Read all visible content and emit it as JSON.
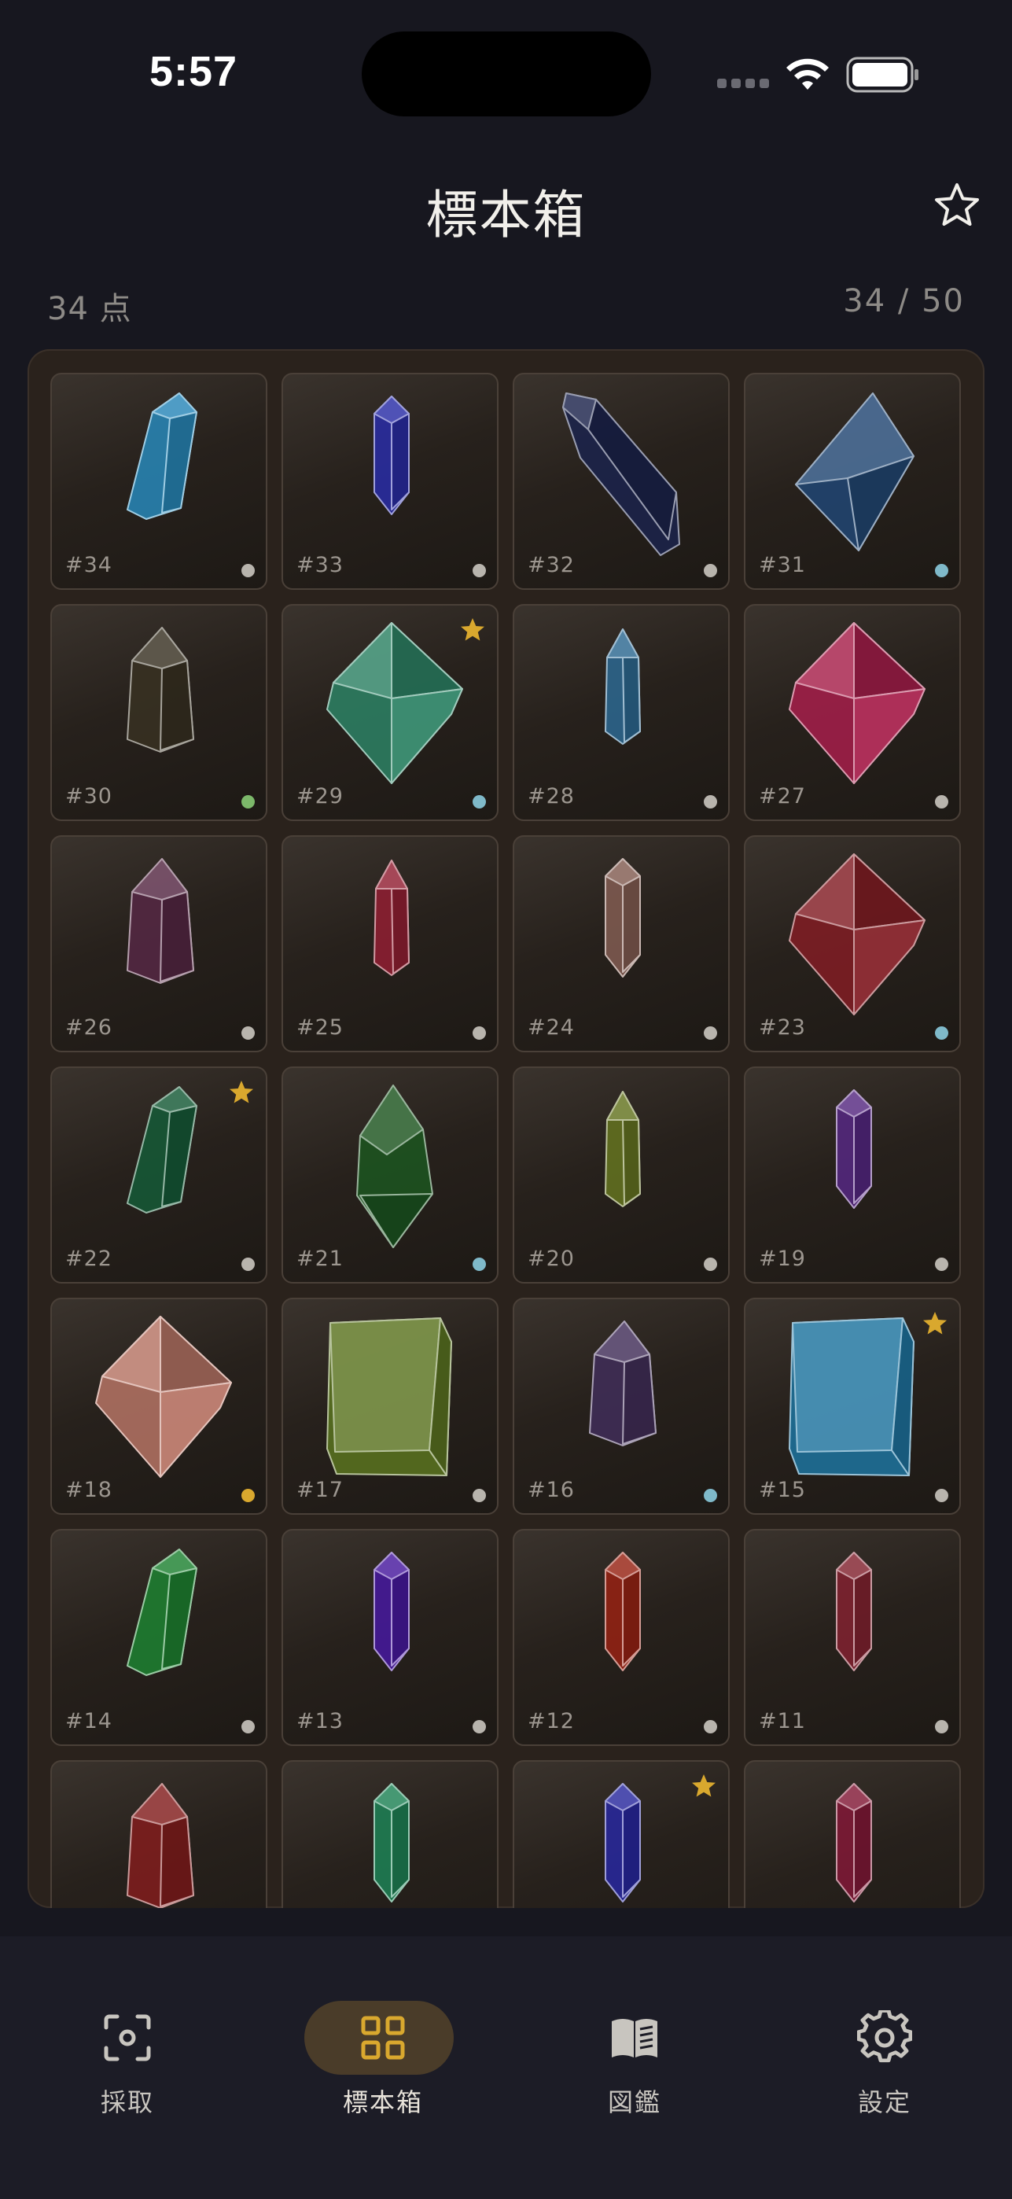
{
  "status_bar": {
    "time": "5:57"
  },
  "header": {
    "title": "標本箱"
  },
  "summary": {
    "count_label": "34 点",
    "progress_label": "34 / 50"
  },
  "colors": {
    "accent_gold": "#d9a82e",
    "dot_grey": "#b8b4ad",
    "dot_blue": "#7fb9c9",
    "dot_green": "#7cb86a",
    "dot_gold": "#d9a82e"
  },
  "specimens": [
    {
      "id": "#34",
      "shape": "prism-tilt",
      "color": "#2a8fc4",
      "dot": "grey",
      "favorite": false
    },
    {
      "id": "#33",
      "shape": "prism",
      "color": "#2b2fb0",
      "dot": "grey",
      "favorite": false
    },
    {
      "id": "#32",
      "shape": "long-diagonal",
      "color": "#1c2550",
      "dot": "grey",
      "favorite": false
    },
    {
      "id": "#31",
      "shape": "diamond-tilt",
      "color": "#234a7a",
      "dot": "blue",
      "favorite": false
    },
    {
      "id": "#30",
      "shape": "prism-wide",
      "color": "#3b3424",
      "dot": "green",
      "favorite": false
    },
    {
      "id": "#29",
      "shape": "octahedron",
      "color": "#2f8a6a",
      "dot": "blue",
      "favorite": true
    },
    {
      "id": "#28",
      "shape": "prism-short",
      "color": "#2f6f9a",
      "dot": "grey",
      "favorite": false
    },
    {
      "id": "#27",
      "shape": "octahedron",
      "color": "#b0204f",
      "dot": "grey",
      "favorite": false
    },
    {
      "id": "#26",
      "shape": "prism-wide",
      "color": "#5a2a48",
      "dot": "grey",
      "favorite": false
    },
    {
      "id": "#25",
      "shape": "prism-short",
      "color": "#9a2135",
      "dot": "grey",
      "favorite": false
    },
    {
      "id": "#24",
      "shape": "prism",
      "color": "#8a6256",
      "dot": "grey",
      "favorite": false
    },
    {
      "id": "#23",
      "shape": "octahedron",
      "color": "#8a1e26",
      "dot": "blue",
      "favorite": false
    },
    {
      "id": "#22",
      "shape": "prism-tilt",
      "color": "#16603a",
      "dot": "grey",
      "favorite": true
    },
    {
      "id": "#21",
      "shape": "bipyramid",
      "color": "#1d5a22",
      "dot": "blue",
      "favorite": false
    },
    {
      "id": "#20",
      "shape": "prism-short",
      "color": "#6a7a22",
      "dot": "grey",
      "favorite": false
    },
    {
      "id": "#19",
      "shape": "prism",
      "color": "#5a2a8a",
      "dot": "grey",
      "favorite": false
    },
    {
      "id": "#18",
      "shape": "octahedron",
      "color": "#c07a6a",
      "dot": "gold",
      "favorite": false
    },
    {
      "id": "#17",
      "shape": "cube",
      "color": "#5f7a22",
      "dot": "grey",
      "favorite": false
    },
    {
      "id": "#16",
      "shape": "prism-wide",
      "color": "#44305e",
      "dot": "blue",
      "favorite": false
    },
    {
      "id": "#15",
      "shape": "cube",
      "color": "#1e7aa8",
      "dot": "grey",
      "favorite": true
    },
    {
      "id": "#14",
      "shape": "prism-tilt",
      "color": "#1f8a34",
      "dot": "grey",
      "favorite": false
    },
    {
      "id": "#13",
      "shape": "prism",
      "color": "#4a1aa8",
      "dot": "grey",
      "favorite": false
    },
    {
      "id": "#12",
      "shape": "prism",
      "color": "#a02414",
      "dot": "grey",
      "favorite": false
    },
    {
      "id": "#11",
      "shape": "prism",
      "color": "#8a2432",
      "dot": "grey",
      "favorite": false
    },
    {
      "id": "",
      "shape": "prism-wide",
      "color": "#8a1e1e",
      "dot": "none",
      "favorite": false
    },
    {
      "id": "",
      "shape": "prism",
      "color": "#1f8a5a",
      "dot": "none",
      "favorite": false
    },
    {
      "id": "",
      "shape": "prism",
      "color": "#2a2aa8",
      "dot": "none",
      "favorite": true
    },
    {
      "id": "",
      "shape": "prism",
      "color": "#8a1a3a",
      "dot": "none",
      "favorite": false
    }
  ],
  "tabs": [
    {
      "label": "採取",
      "icon": "scan-icon",
      "active": false
    },
    {
      "label": "標本箱",
      "icon": "grid-icon",
      "active": true
    },
    {
      "label": "図鑑",
      "icon": "book-icon",
      "active": false
    },
    {
      "label": "設定",
      "icon": "gear-icon",
      "active": false
    }
  ]
}
